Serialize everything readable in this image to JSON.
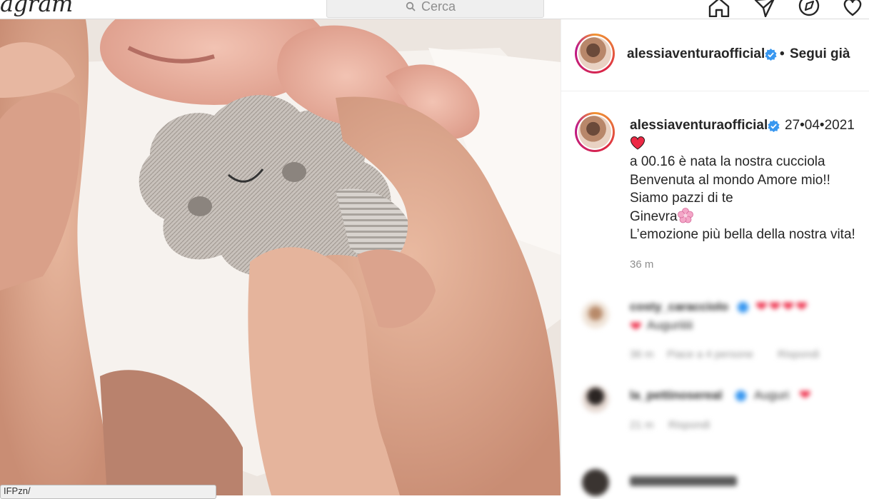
{
  "nav": {
    "logo_text": "agram",
    "search_placeholder": "Cerca",
    "icons": [
      "home-icon",
      "direct-send-icon",
      "explore-compass-icon",
      "heart-icon"
    ]
  },
  "post": {
    "header": {
      "username": "alessiaventuraofficial",
      "verified": true,
      "separator": "•",
      "follow_label": "Segui già"
    },
    "caption": {
      "username": "alessiaventuraofficial",
      "date": "27•04•2021",
      "lines": [
        "a 00.16 è nata la nostra cucciola",
        "Benvenuta al mondo Amore mio!!",
        "Siamo pazzi di te",
        "Ginevra",
        "L’emozione più bella della nostra vita!"
      ],
      "age": "36 m"
    },
    "comments": [
      {
        "username": "costy_caracciolo",
        "text": "Auguriiiii",
        "meta_time": "36 m",
        "meta_likes": "Piace a 4 persone",
        "reply": "Rispondi"
      },
      {
        "username": "la_pettinosereal",
        "text": "Auguri",
        "meta_time": "21 m",
        "reply": "Rispondi"
      }
    ]
  },
  "status_bar": {
    "url_text": "IFPzn/"
  },
  "colors": {
    "heart": "#ed2945",
    "verified": "#3897f0",
    "secondary_text": "#8e8e8e",
    "border": "#dbdbdb"
  }
}
